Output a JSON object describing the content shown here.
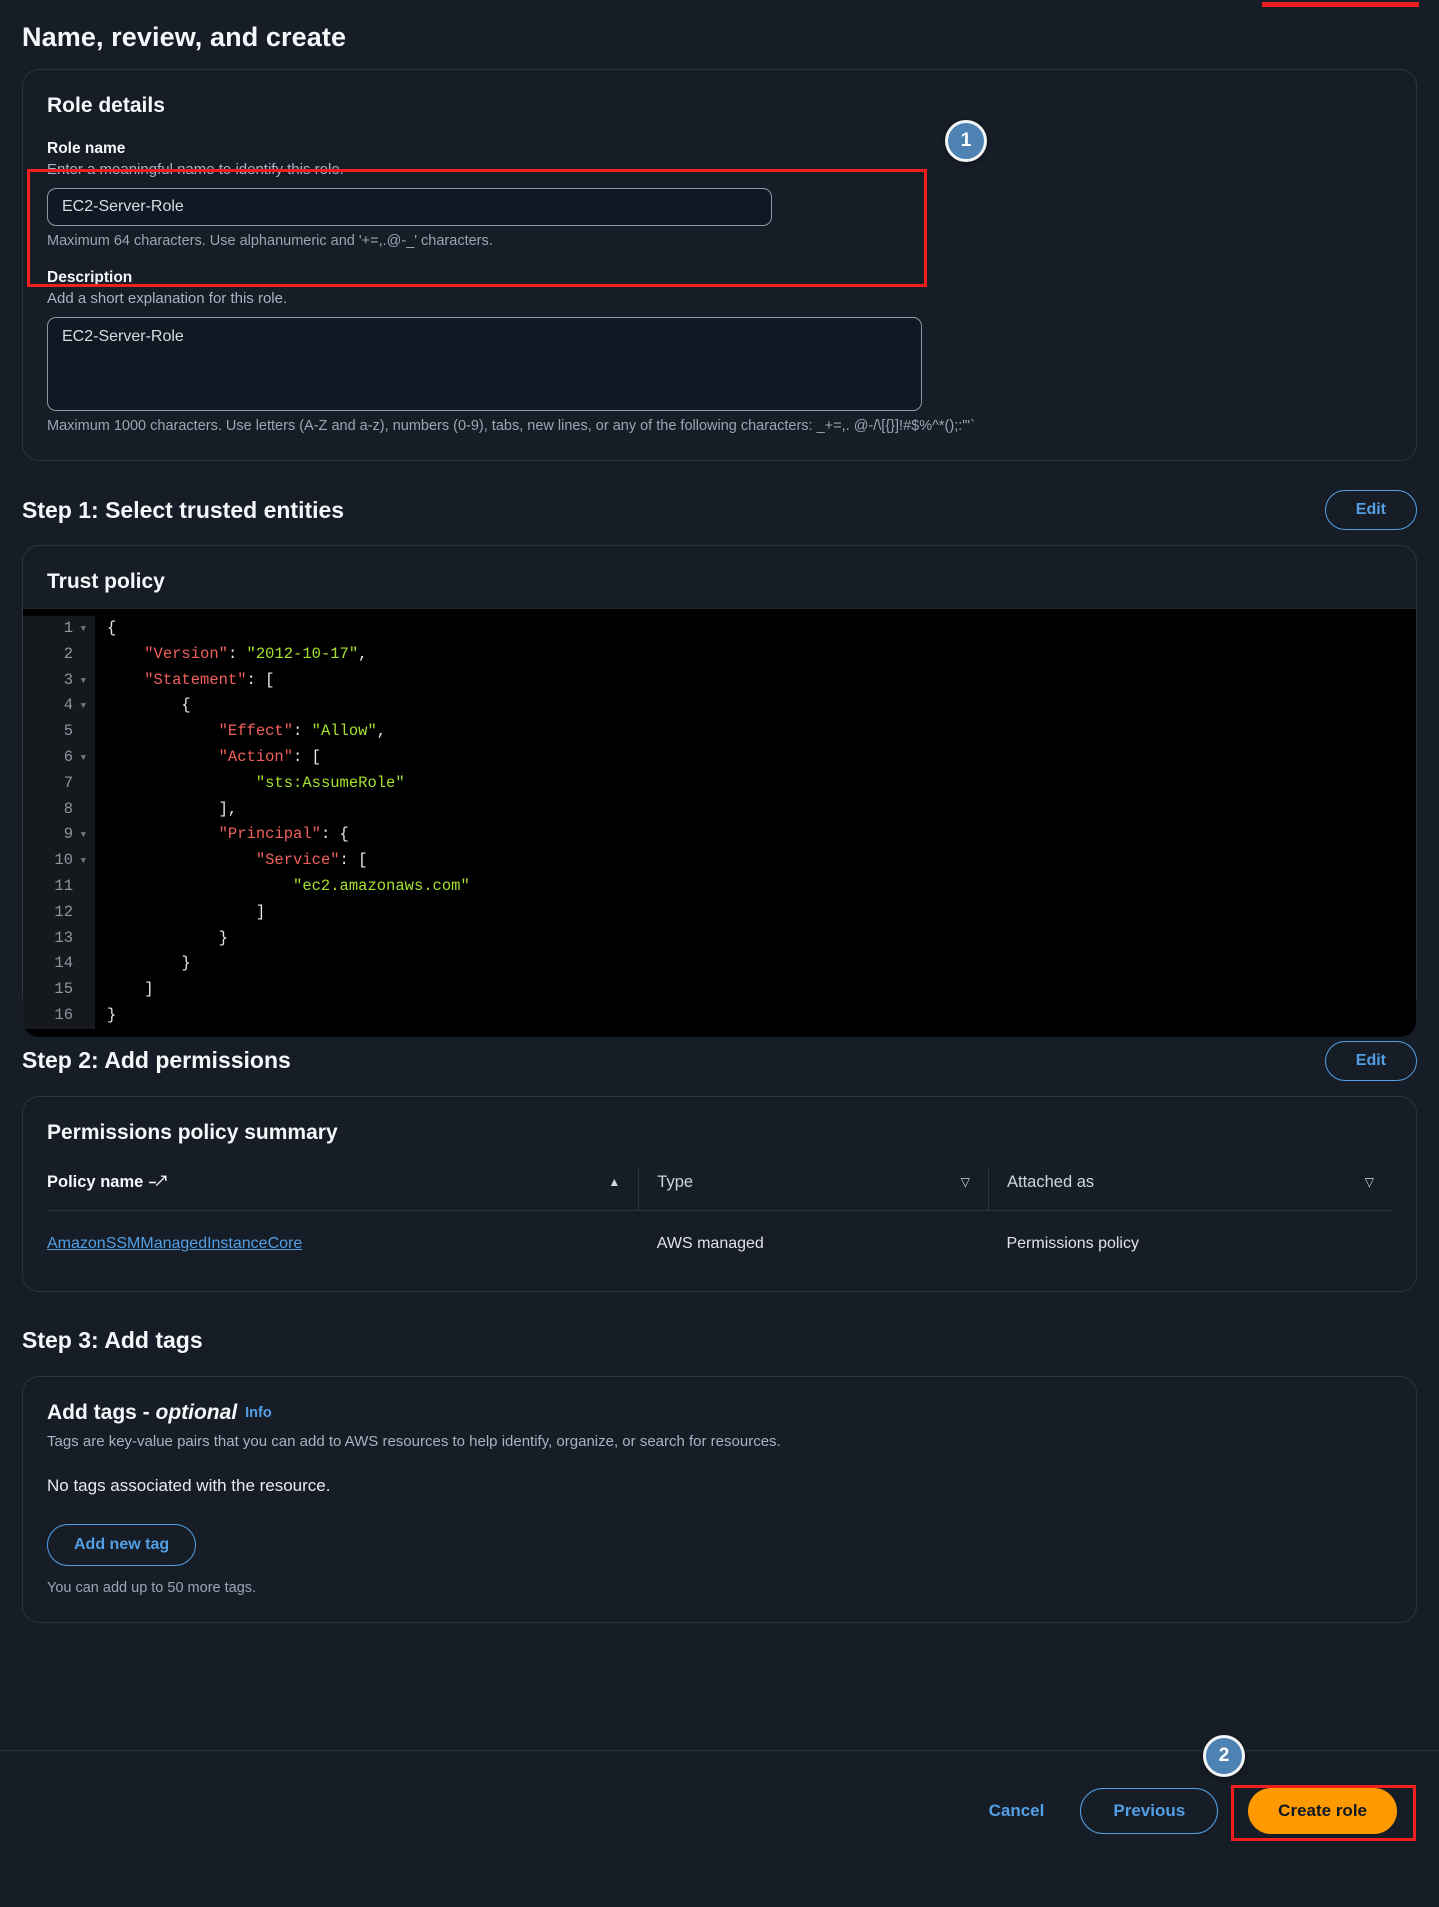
{
  "page_title": "Name, review, and create",
  "annotations": {
    "badge_1": "1",
    "badge_2": "2"
  },
  "role_details": {
    "card_title": "Role details",
    "role_name": {
      "label": "Role name",
      "description": "Enter a meaningful name to identify this role.",
      "value": "EC2-Server-Role",
      "placeholder": "",
      "constraint": "Maximum 64 characters. Use alphanumeric and '+=,.@-_' characters."
    },
    "description": {
      "label": "Description",
      "description": "Add a short explanation for this role.",
      "value": "EC2-Server-Role",
      "placeholder": "",
      "constraint": "Maximum 1000 characters. Use letters (A-Z and a-z), numbers (0-9), tabs, new lines, or any of the following characters: _+=,. @-/\\[{}]!#$%^*();:\"'`"
    }
  },
  "step1": {
    "heading": "Step 1: Select trusted entities",
    "edit_label": "Edit",
    "card_title": "Trust policy",
    "code_lines": [
      "1",
      "2",
      "3",
      "4",
      "5",
      "6",
      "7",
      "8",
      "9",
      "10",
      "11",
      "12",
      "13",
      "14",
      "15",
      "16"
    ],
    "trust_policy_json": "{\n    \"Version\": \"2012-10-17\",\n    \"Statement\": [\n        {\n            \"Effect\": \"Allow\",\n            \"Action\": [\n                \"sts:AssumeRole\"\n            ],\n            \"Principal\": {\n                \"Service\": [\n                    \"ec2.amazonaws.com\"\n                ]\n            }\n        }\n    ]\n}"
  },
  "step2": {
    "heading": "Step 2: Add permissions",
    "edit_label": "Edit",
    "card_title": "Permissions policy summary",
    "table": {
      "columns": [
        {
          "label": "Policy name",
          "sort": "ascending",
          "sort_glyph": "▲",
          "external_link": true
        },
        {
          "label": "Type",
          "sort": "none",
          "sort_glyph": "▽",
          "external_link": false
        },
        {
          "label": "Attached as",
          "sort": "none",
          "sort_glyph": "▽",
          "external_link": false
        }
      ],
      "rows": [
        {
          "policy_name": "AmazonSSMManagedInstanceCore",
          "type": "AWS managed",
          "attached_as": "Permissions policy"
        }
      ]
    }
  },
  "step3": {
    "heading": "Step 3: Add tags",
    "card_title_main": "Add tags - ",
    "card_title_optional": "optional",
    "info_label": "Info",
    "description": "Tags are key-value pairs that you can add to AWS resources to help identify, organize, or search for resources.",
    "empty_state": "No tags associated with the resource.",
    "add_tag_label": "Add new tag",
    "limit_text": "You can add up to 50 more tags."
  },
  "footer": {
    "cancel_label": "Cancel",
    "previous_label": "Previous",
    "create_label": "Create role"
  },
  "colors": {
    "background": "#161d26",
    "accent_link": "#539fe5",
    "primary_button": "#ff9900",
    "annotation_red": "#f01f1f",
    "badge_blue": "#4d82b3",
    "code_key": "#f0605d",
    "code_string": "#a6e22e"
  }
}
